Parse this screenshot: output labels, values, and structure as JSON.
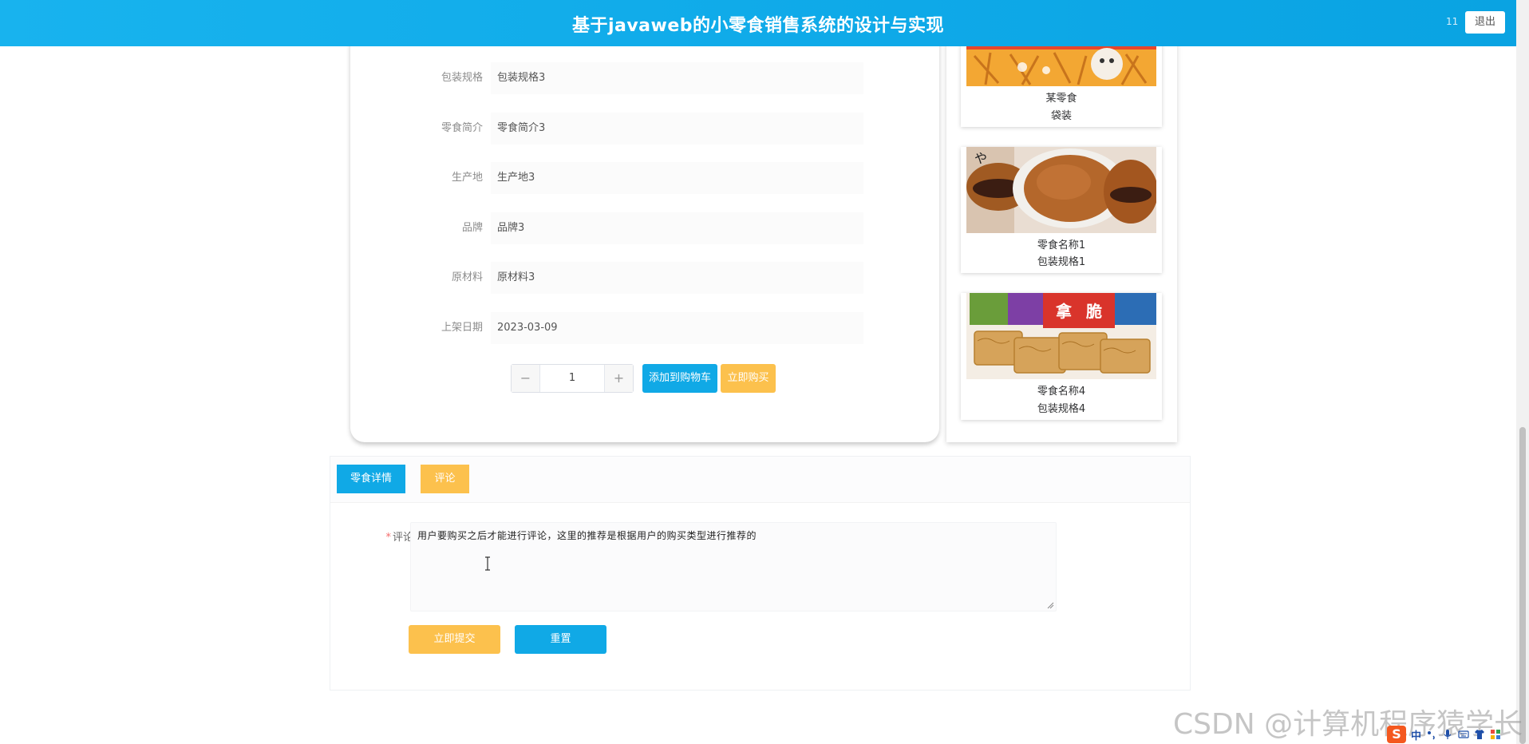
{
  "header": {
    "title": "基于javaweb的小零食销售系统的设计与实现",
    "user": "11",
    "logout_label": "退出"
  },
  "detail": {
    "fields": [
      {
        "label": "包装规格",
        "value": "包装规格3"
      },
      {
        "label": "零食简介",
        "value": "零食简介3"
      },
      {
        "label": "生产地",
        "value": "生产地3"
      },
      {
        "label": "品牌",
        "value": "品牌3"
      },
      {
        "label": "原材料",
        "value": "原材料3"
      },
      {
        "label": "上架日期",
        "value": "2023-03-09"
      }
    ],
    "quantity": "1",
    "minus_symbol": "−",
    "plus_symbol": "+",
    "add_to_cart_label": "添加到购物车",
    "buy_now_label": "立即购买"
  },
  "recommendations": [
    {
      "name": "某零食",
      "spec": "袋装"
    },
    {
      "name": "零食名称1",
      "spec": "包装规格1"
    },
    {
      "name": "零食名称4",
      "spec": "包装规格4"
    }
  ],
  "tabs": {
    "detail_label": "零食详情",
    "comment_label": "评论"
  },
  "comment_form": {
    "required_mark": "*",
    "label": "评论",
    "text": "用户要购买之后才能进行评论，这里的推荐是根据用户的购买类型进行推荐的",
    "submit_label": "立即提交",
    "reset_label": "重置"
  },
  "watermark": "CSDN @计算机程序猿学长",
  "tray": {
    "ime_logo": "S",
    "lang": "中"
  },
  "colors": {
    "primary": "#10a9e6",
    "warning": "#fcc14d",
    "danger": "#f56c6c"
  }
}
